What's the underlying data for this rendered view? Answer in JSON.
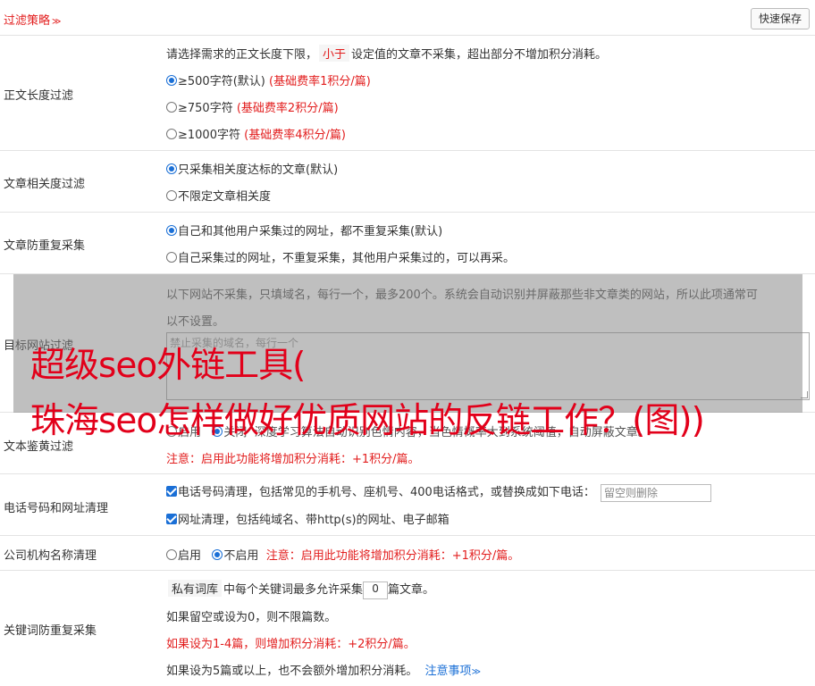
{
  "header": {
    "title": "过滤策略",
    "title_chevron": "≫",
    "save_label": "快速保存"
  },
  "sections": {
    "length": {
      "label": "正文长度过滤",
      "desc_pre": "请选择需求的正文长度下限，",
      "desc_tag": "小于",
      "desc_post": "设定值的文章不采集，超出部分不增加积分消耗。",
      "options": [
        {
          "label": "≥500字符(默认)",
          "note": "(基础费率1积分/篇)",
          "checked": true
        },
        {
          "label": "≥750字符",
          "note": "(基础费率2积分/篇)",
          "checked": false
        },
        {
          "label": "≥1000字符",
          "note": "(基础费率4积分/篇)",
          "checked": false
        }
      ]
    },
    "relevance": {
      "label": "文章相关度过滤",
      "options": [
        {
          "label": "只采集相关度达标的文章(默认)",
          "checked": true
        },
        {
          "label": "不限定文章相关度",
          "checked": false
        }
      ]
    },
    "dedupe": {
      "label": "文章防重复采集",
      "options": [
        {
          "label": "自己和其他用户采集过的网址，都不重复采集(默认)",
          "checked": true
        },
        {
          "label": "自己采集过的网址，不重复采集，其他用户采集过的，可以再采。",
          "checked": false
        }
      ]
    },
    "site_filter": {
      "label": "目标网站过滤",
      "desc_line1": "以下网站不采集，只填域名，每行一个，最多200个。系统会自动识别并屏蔽那些非文章类的网站，所以此项通常可",
      "desc_line2": "以不设置。",
      "placeholder": "禁止采集的域名，每行一个"
    },
    "porn_filter": {
      "label": "文本鉴黄过滤",
      "opt_on": "启用",
      "opt_off": "关闭",
      "desc": "深度学习算法自动识别色情内容，当色情概率大到系统阈值，自动屏蔽文章。",
      "note": "注意：启用此功能将增加积分消耗：+1积分/篇。"
    },
    "phone_clean": {
      "label": "电话号码和网址清理",
      "phone_text": "电话号码清理，包括常见的手机号、座机号、400电话格式，或替换成如下电话：",
      "phone_placeholder": "留空则删除",
      "url_text": "网址清理，包括纯域名、带http(s)的网址、电子邮箱"
    },
    "org_clean": {
      "label": "公司机构名称清理",
      "opt_on": "启用",
      "opt_off": "不启用",
      "note": "注意：启用此功能将增加积分消耗：+1积分/篇。"
    },
    "keyword_dedupe": {
      "label": "关键词防重复采集",
      "tag": "私有词库",
      "line1_a": "中每个关键词最多允许采集",
      "value": "0",
      "line1_b": "篇文章。",
      "line2": "如果留空或设为0，则不限篇数。",
      "line3": "如果设为1-4篇，则增加积分消耗：+2积分/篇。",
      "line4": "如果设为5篇或以上，也不会额外增加积分消耗。",
      "link": "注意事项",
      "link_chevron": "≫"
    }
  },
  "watermark": {
    "line1": "超级seo外链工具(",
    "line2": "珠海seo怎样做好优质网站的反链工作？(图))"
  }
}
